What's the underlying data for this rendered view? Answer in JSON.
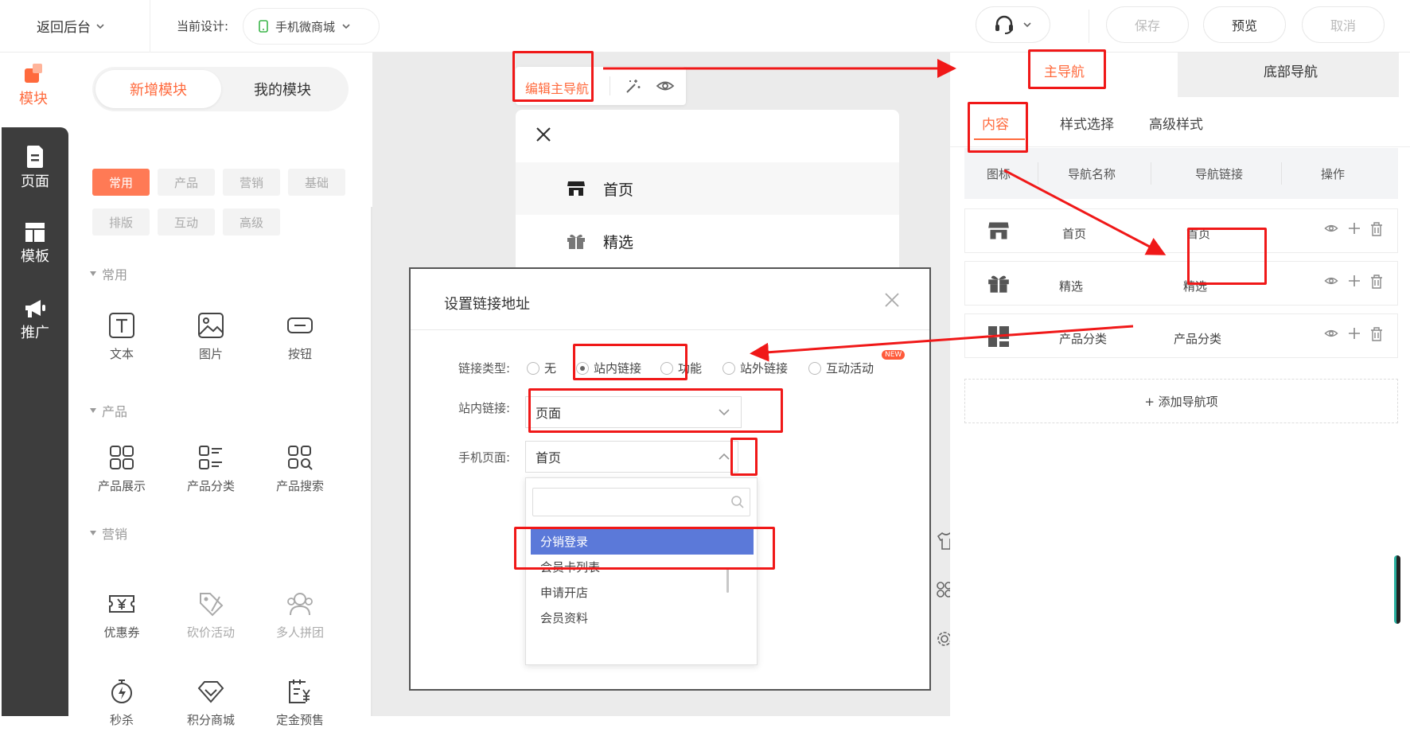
{
  "header": {
    "back_label": "返回后台",
    "current_design_label": "当前设计:",
    "design_name": "手机微商城",
    "save_label": "保存",
    "preview_label": "预览",
    "cancel_label": "取消"
  },
  "rail": {
    "items": [
      {
        "label": "模块",
        "icon": "modules-icon"
      },
      {
        "label": "页面",
        "icon": "page-icon"
      },
      {
        "label": "模板",
        "icon": "template-icon"
      },
      {
        "label": "推广",
        "icon": "megaphone-icon"
      }
    ]
  },
  "modules": {
    "tab_new": "新增模块",
    "tab_mine": "我的模块",
    "filters": [
      "常用",
      "产品",
      "营销",
      "基础",
      "排版",
      "互动",
      "高级"
    ],
    "sections": [
      {
        "title": "常用",
        "tools": [
          "文本",
          "图片",
          "按钮"
        ]
      },
      {
        "title": "产品",
        "tools": [
          "产品展示",
          "产品分类",
          "产品搜索"
        ]
      },
      {
        "title": "营销",
        "tools": [
          "优惠券",
          "砍价活动",
          "多人拼团",
          "秒杀",
          "积分商城",
          "定金预售"
        ]
      }
    ]
  },
  "canvas": {
    "edit_tab_label": "编辑主导航",
    "nav_items": [
      "首页",
      "精选"
    ]
  },
  "dialog": {
    "title": "设置链接地址",
    "link_type_label": "链接类型:",
    "link_types": [
      "无",
      "站内链接",
      "功能",
      "站外链接",
      "互动活动"
    ],
    "new_badge": "NEW",
    "inner_link_label": "站内链接:",
    "inner_link_value": "页面",
    "mobile_page_label": "手机页面:",
    "mobile_page_value": "首页",
    "dropdown_options": [
      "分销登录",
      "会员卡列表",
      "申请开店",
      "会员资料"
    ]
  },
  "right_panel": {
    "tab_main": "主导航",
    "tab_bottom": "底部导航",
    "subtabs": [
      "内容",
      "样式选择",
      "高级样式"
    ],
    "columns": [
      "图标",
      "导航名称",
      "导航链接",
      "操作"
    ],
    "rows": [
      {
        "name": "首页",
        "link": "首页",
        "icon": "store-icon"
      },
      {
        "name": "精选",
        "link": "精选",
        "icon": "gift-icon"
      },
      {
        "name": "产品分类",
        "link": "产品分类",
        "icon": "category-grid-icon"
      }
    ],
    "add_label": "+ 添加导航项"
  },
  "colors": {
    "accent": "#ff6a3d",
    "annotation": "#f01818",
    "selected_option": "#5b79d9",
    "rail_bg": "#3d3d3d"
  }
}
